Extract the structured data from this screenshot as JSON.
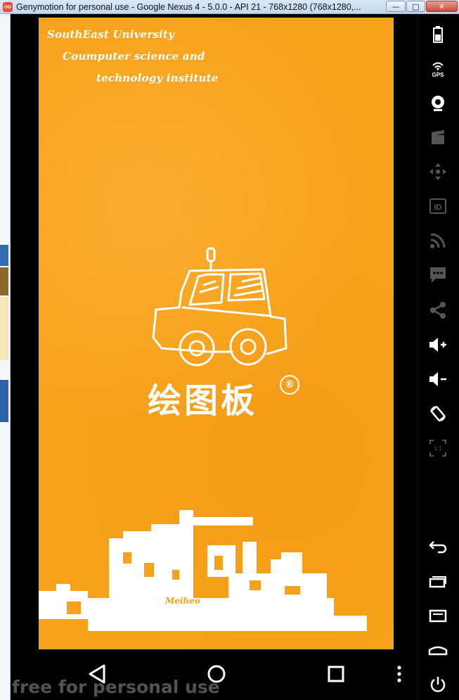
{
  "window": {
    "title": "Genymotion for personal use - Google Nexus 4 - 5.0.0 - API 21 - 768x1280 (768x1280,...",
    "app_icon_text": "oo",
    "minimize_glyph": "—",
    "maximize_glyph": "□",
    "close_glyph": "✕"
  },
  "splash": {
    "university": "SouthEast University",
    "institute_line1": "Coumputer science and",
    "institute_line2": "technology institute",
    "app_name": "绘图板",
    "registered_mark": "®",
    "brand": "Meiheo"
  },
  "watermark": "free for personal use",
  "toolbar": {
    "items": [
      "battery-icon",
      "gps-icon",
      "webcam-icon",
      "screencast-icon",
      "remote-control-icon",
      "id-icon",
      "network-icon",
      "sms-icon",
      "share-icon",
      "volume-up-icon",
      "volume-down-icon",
      "rotate-icon",
      "pixel-perfect-icon",
      "back-icon",
      "recent-apps-icon",
      "menu-icon",
      "home-icon",
      "power-icon"
    ],
    "gps_label": "GPS",
    "id_label": "ID",
    "pixel_label": "1:1"
  },
  "colors": {
    "splash_orange": "#f7a11a",
    "chrome_blue": "#c3d7ee"
  }
}
